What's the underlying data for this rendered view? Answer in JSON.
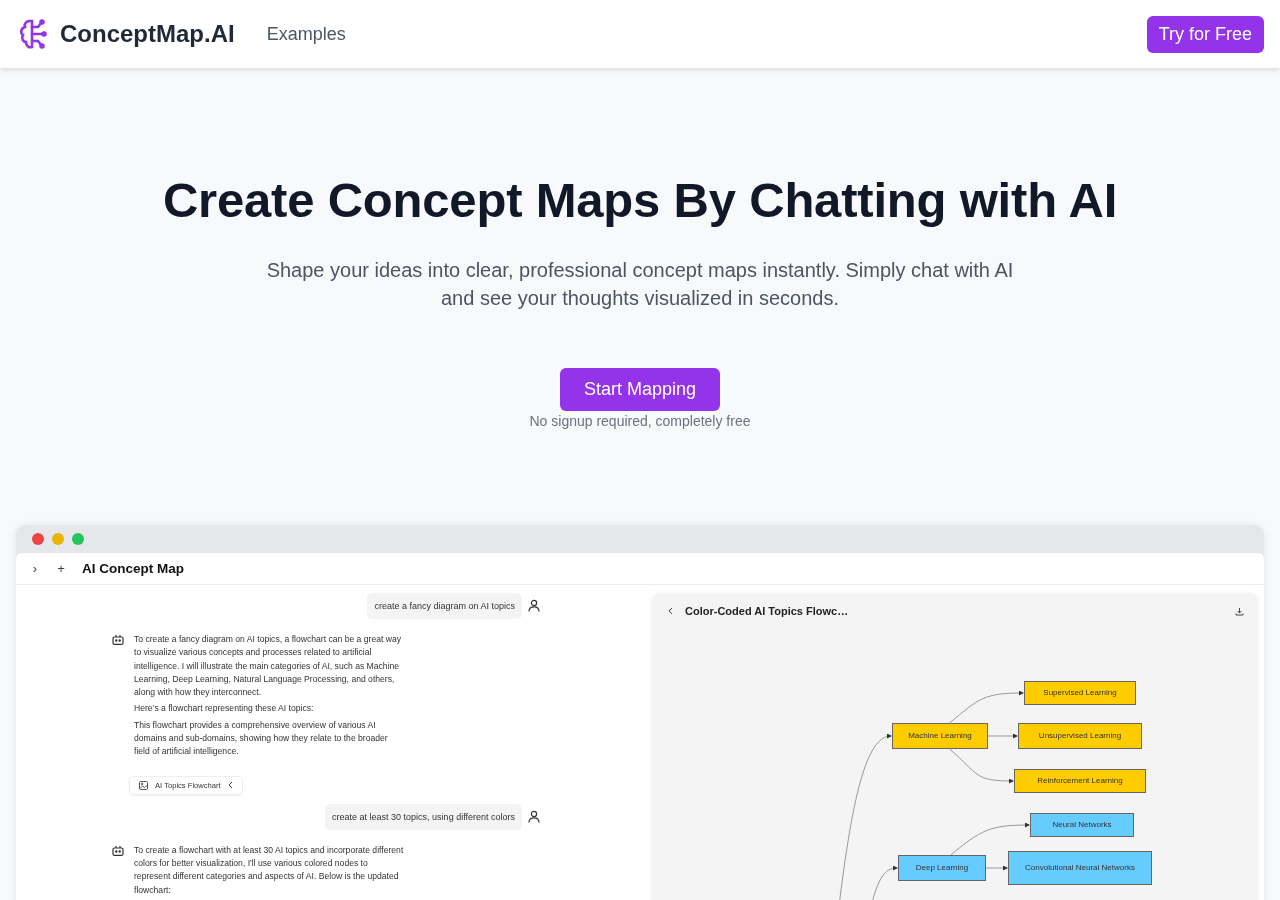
{
  "header": {
    "brand": "ConceptMap.AI",
    "nav": [
      {
        "label": "Examples"
      }
    ],
    "cta": "Try for Free"
  },
  "hero": {
    "title": "Create Concept Maps By Chatting with AI",
    "subtitle": "Shape your ideas into clear, professional concept maps instantly. Simply chat with AI and see your thoughts visualized in seconds.",
    "button": "Start Mapping",
    "note": "No signup required, completely free"
  },
  "preview": {
    "title": "AI Concept Map",
    "toolbar": [
      "›",
      "+"
    ],
    "messages": [
      {
        "kind": "user",
        "text": "create a fancy diagram on AI topics"
      },
      {
        "kind": "assistant",
        "paragraphs": [
          "To create a fancy diagram on AI topics, a flowchart can be a great way to visualize various concepts and processes related to artificial intelligence. I will illustrate the main categories of AI, such as Machine Learning, Deep Learning, Natural Language Processing, and others, along with how they interconnect.",
          "Here’s a flowchart representing these AI topics:",
          "This flowchart provides a comprehensive overview of various AI domains and sub-domains, showing how they relate to the broader field of artificial intelligence."
        ]
      },
      {
        "kind": "attachment",
        "text": "AI Topics Flowchart"
      },
      {
        "kind": "user",
        "text": "create at least 30 topics, using different colors"
      },
      {
        "kind": "assistant",
        "paragraphs": [
          "To create a flowchart with at least 30 AI topics and incorporate different colors for better visualization, I'll use various colored nodes to represent different categories and aspects of AI. Below is the updated flowchart:"
        ]
      }
    ],
    "diagram": {
      "title": "Color-Coded AI Topics Flowc…",
      "nodes": [
        {
          "label": "Machine Learning",
          "color": "#ffcc00",
          "children": [
            {
              "label": "Supervised Learning",
              "color": "#ffcc00"
            },
            {
              "label": "Unsupervised Learning",
              "color": "#ffcc00"
            },
            {
              "label": "Reinforcement Learning",
              "color": "#ffcc00"
            }
          ]
        },
        {
          "label": "Deep Learning",
          "color": "#66ccff",
          "children": [
            {
              "label": "Neural Networks",
              "color": "#66ccff"
            },
            {
              "label": "Convolutional Neural Networks",
              "color": "#66ccff"
            }
          ]
        }
      ]
    }
  }
}
